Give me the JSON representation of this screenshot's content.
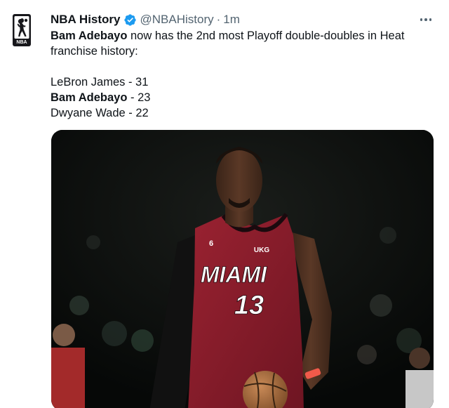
{
  "tweet": {
    "author_name": "NBA History",
    "author_handle": "@NBAHistory",
    "separator": "·",
    "time": "1m",
    "text": {
      "line1_bold": "Bam Adebayo",
      "line1_rest": " now has the 2nd most Playoff double-doubles in Heat franchise history:",
      "list": [
        {
          "name": "LeBron James",
          "value": " - 31",
          "bold": false
        },
        {
          "name": "Bam Adebayo",
          "value": " - 23",
          "bold": true
        },
        {
          "name": "Dwyane Wade",
          "value": " - 22",
          "bold": false
        }
      ]
    },
    "media": {
      "jersey_text": "MIAMI",
      "jersey_number": "13",
      "patch_number": "6",
      "sponsor": "UKG"
    }
  },
  "icons": {
    "avatar": "nba-logo-icon",
    "verified": "verified-badge-icon",
    "more": "more-options-icon"
  },
  "colors": {
    "verified_blue": "#1d9bf0",
    "secondary_text": "#536471",
    "jersey_red": "#8e1d2c"
  }
}
